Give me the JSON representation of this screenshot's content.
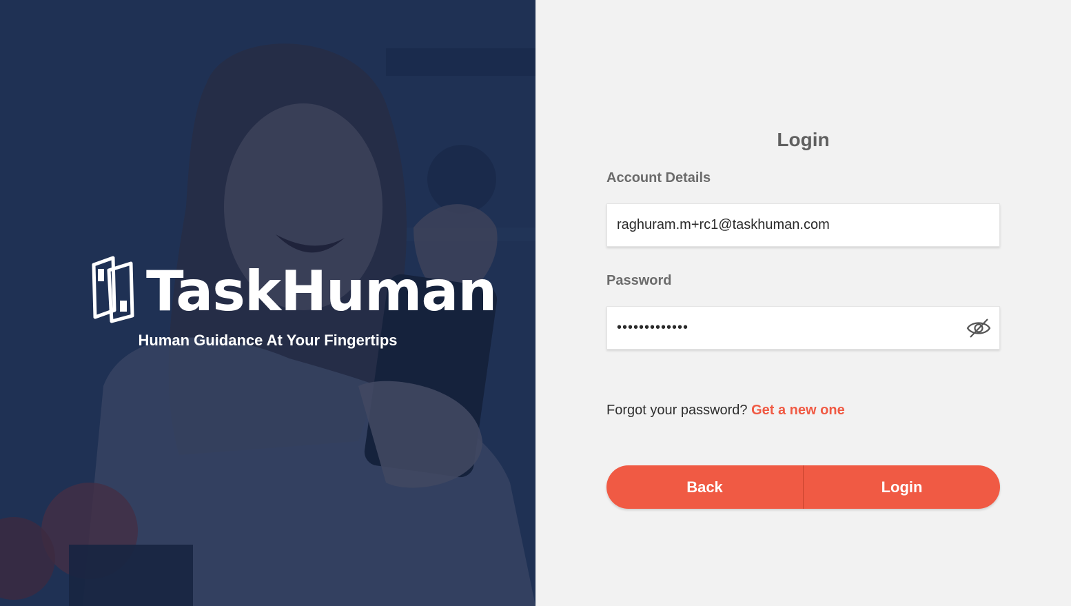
{
  "hero": {
    "brand_name": "TaskHuman",
    "tagline": "Human Guidance At Your Fingertips",
    "logo_icon": "taskhuman-logo-icon"
  },
  "login": {
    "title": "Login",
    "account_label": "Account Details",
    "email_value": "raghuram.m+rc1@taskhuman.com",
    "password_label": "Password",
    "password_value": "•••••••••••••",
    "password_toggle_icon": "eye-off-icon",
    "forgot_text": "Forgot your password?",
    "forgot_link": "Get a new one",
    "back_button": "Back",
    "login_button": "Login"
  },
  "colors": {
    "accent": "#f05a44",
    "panel_bg": "#f2f2f2",
    "hero_bg": "#24365a"
  }
}
